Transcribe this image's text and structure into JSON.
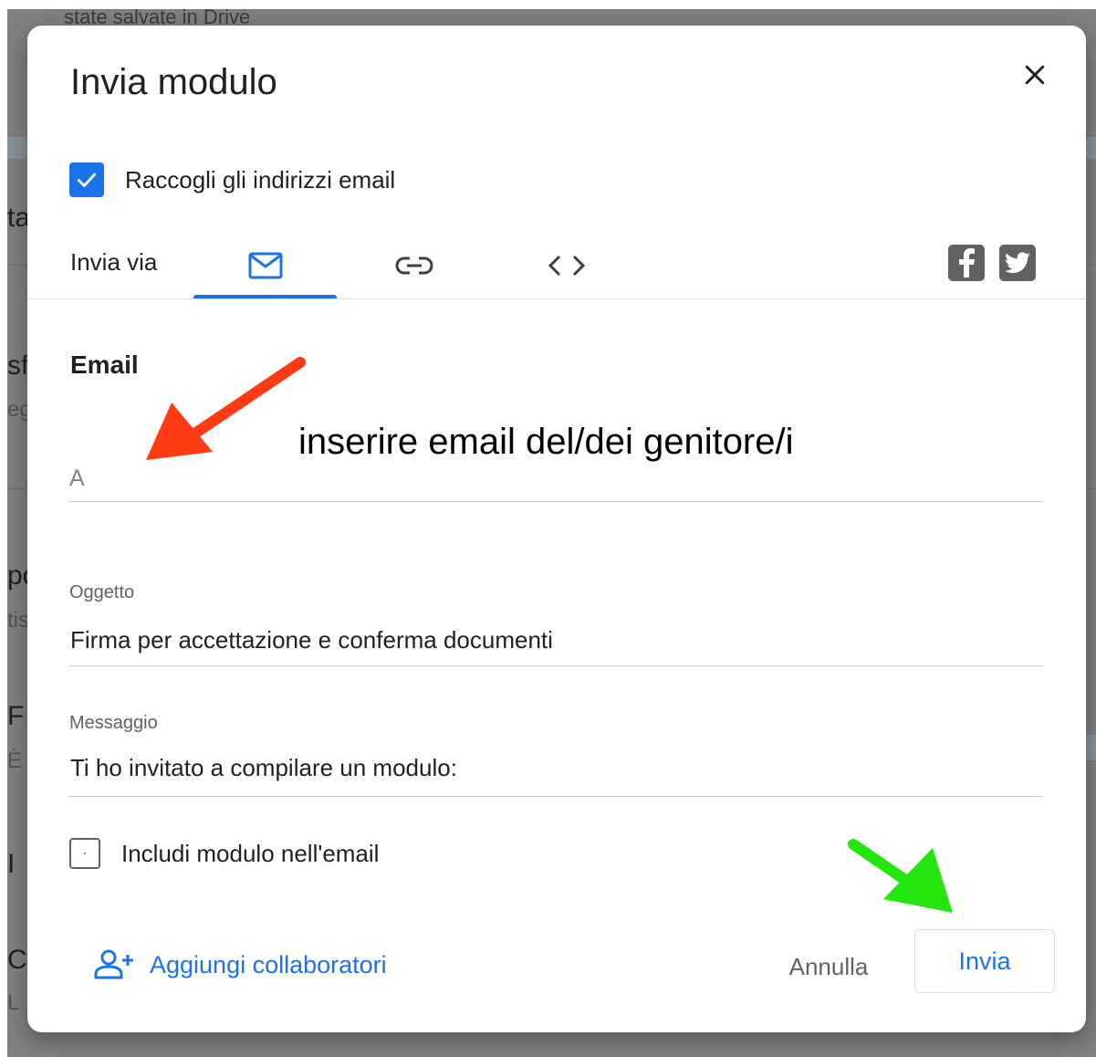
{
  "background": {
    "top_text": "state salvate in Drive",
    "fragments": [
      "ta",
      "sf",
      "eg",
      "po",
      "tis",
      "F",
      "È",
      "I",
      "C",
      "L"
    ]
  },
  "dialog": {
    "title": "Invia modulo",
    "close_icon": "close-icon",
    "collect_emails": {
      "label": "Raccogli gli indirizzi email",
      "checked": true
    },
    "send_via": {
      "label": "Invia via",
      "tabs": [
        {
          "icon": "email-icon",
          "selected": true
        },
        {
          "icon": "link-icon",
          "selected": false
        },
        {
          "icon": "embed-code-icon",
          "selected": false
        }
      ],
      "share_icons": [
        "facebook-icon",
        "twitter-icon"
      ]
    },
    "email_section": {
      "heading": "Email",
      "to_placeholder": "A",
      "subject": {
        "label": "Oggetto",
        "value": "Firma per accettazione e conferma documenti"
      },
      "message": {
        "label": "Messaggio",
        "value": "Ti ho invitato a compilare un modulo:"
      },
      "include_form": {
        "label": "Includi modulo nell'email",
        "checked": false
      }
    },
    "footer": {
      "add_collaborators": "Aggiungi collaboratori",
      "cancel": "Annulla",
      "send": "Invia"
    }
  },
  "annotations": {
    "note": "inserire email del/dei genitore/i",
    "arrow_colors": {
      "to_field": "#ff3b14",
      "send_button": "#22e60e"
    }
  },
  "colors": {
    "accent": "#1a73e8",
    "overlay": "#808080"
  }
}
